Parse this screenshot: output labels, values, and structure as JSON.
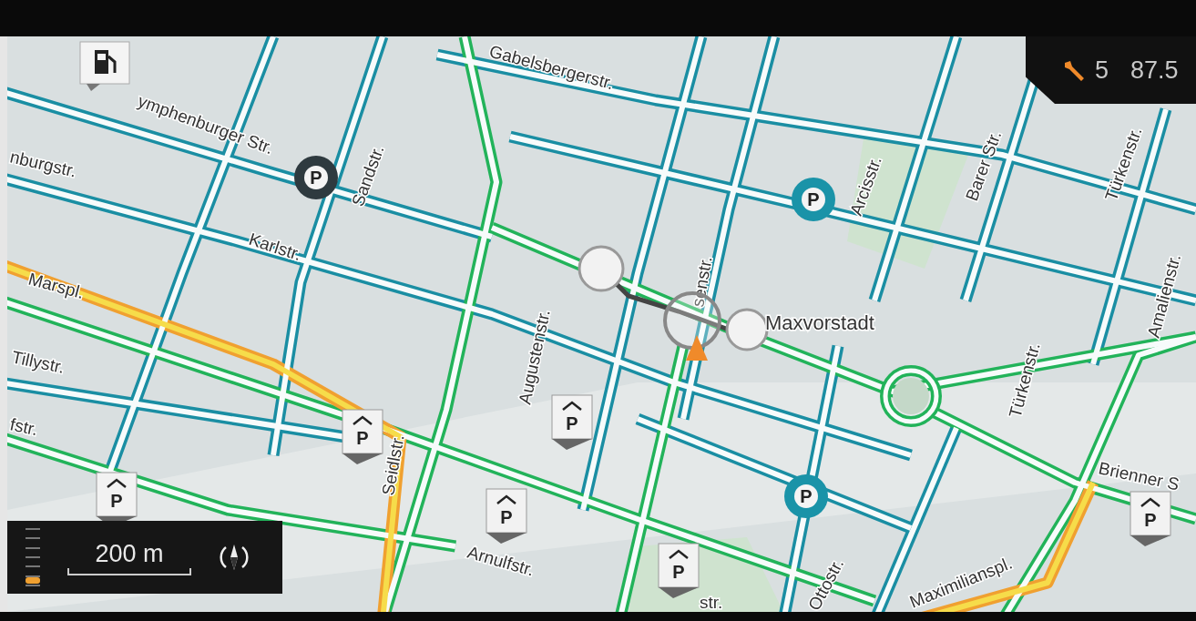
{
  "status": {
    "service_count": "5",
    "radio_frequency": "87.5"
  },
  "street_labels": [
    "ymphenburger Str.",
    "nburgstr.",
    "Karlstr.",
    "Marspl.",
    "Tillystr.",
    "fstr.",
    "Gabelsbergerstr.",
    "Sandstr.",
    "Arcisstr.",
    "Barer Str.",
    "Türkenstr.",
    "Amalienstr.",
    "senstr.",
    "Augustenstr.",
    "Türkenstr.",
    "Seidlstr.",
    "Arnulfstr.",
    "str.",
    "Ottostr.",
    "Maximilianspl.",
    "Brienner S"
  ],
  "district_label": "Maxvorstadt",
  "parking": [
    {
      "kind": "circle",
      "symbol": "P",
      "color": "#2e3a3f"
    },
    {
      "kind": "circle",
      "symbol": "P",
      "color": "#1a93a8"
    },
    {
      "kind": "circle",
      "symbol": "P",
      "color": "#1a93a8"
    },
    {
      "kind": "garage",
      "symbol": "P"
    },
    {
      "kind": "garage",
      "symbol": "P"
    },
    {
      "kind": "garage",
      "symbol": "P"
    },
    {
      "kind": "garage",
      "symbol": "P"
    },
    {
      "kind": "garage",
      "symbol": "P"
    },
    {
      "kind": "garage",
      "symbol": "P"
    }
  ],
  "scale": {
    "distance": "200 m",
    "level": 0.05
  }
}
